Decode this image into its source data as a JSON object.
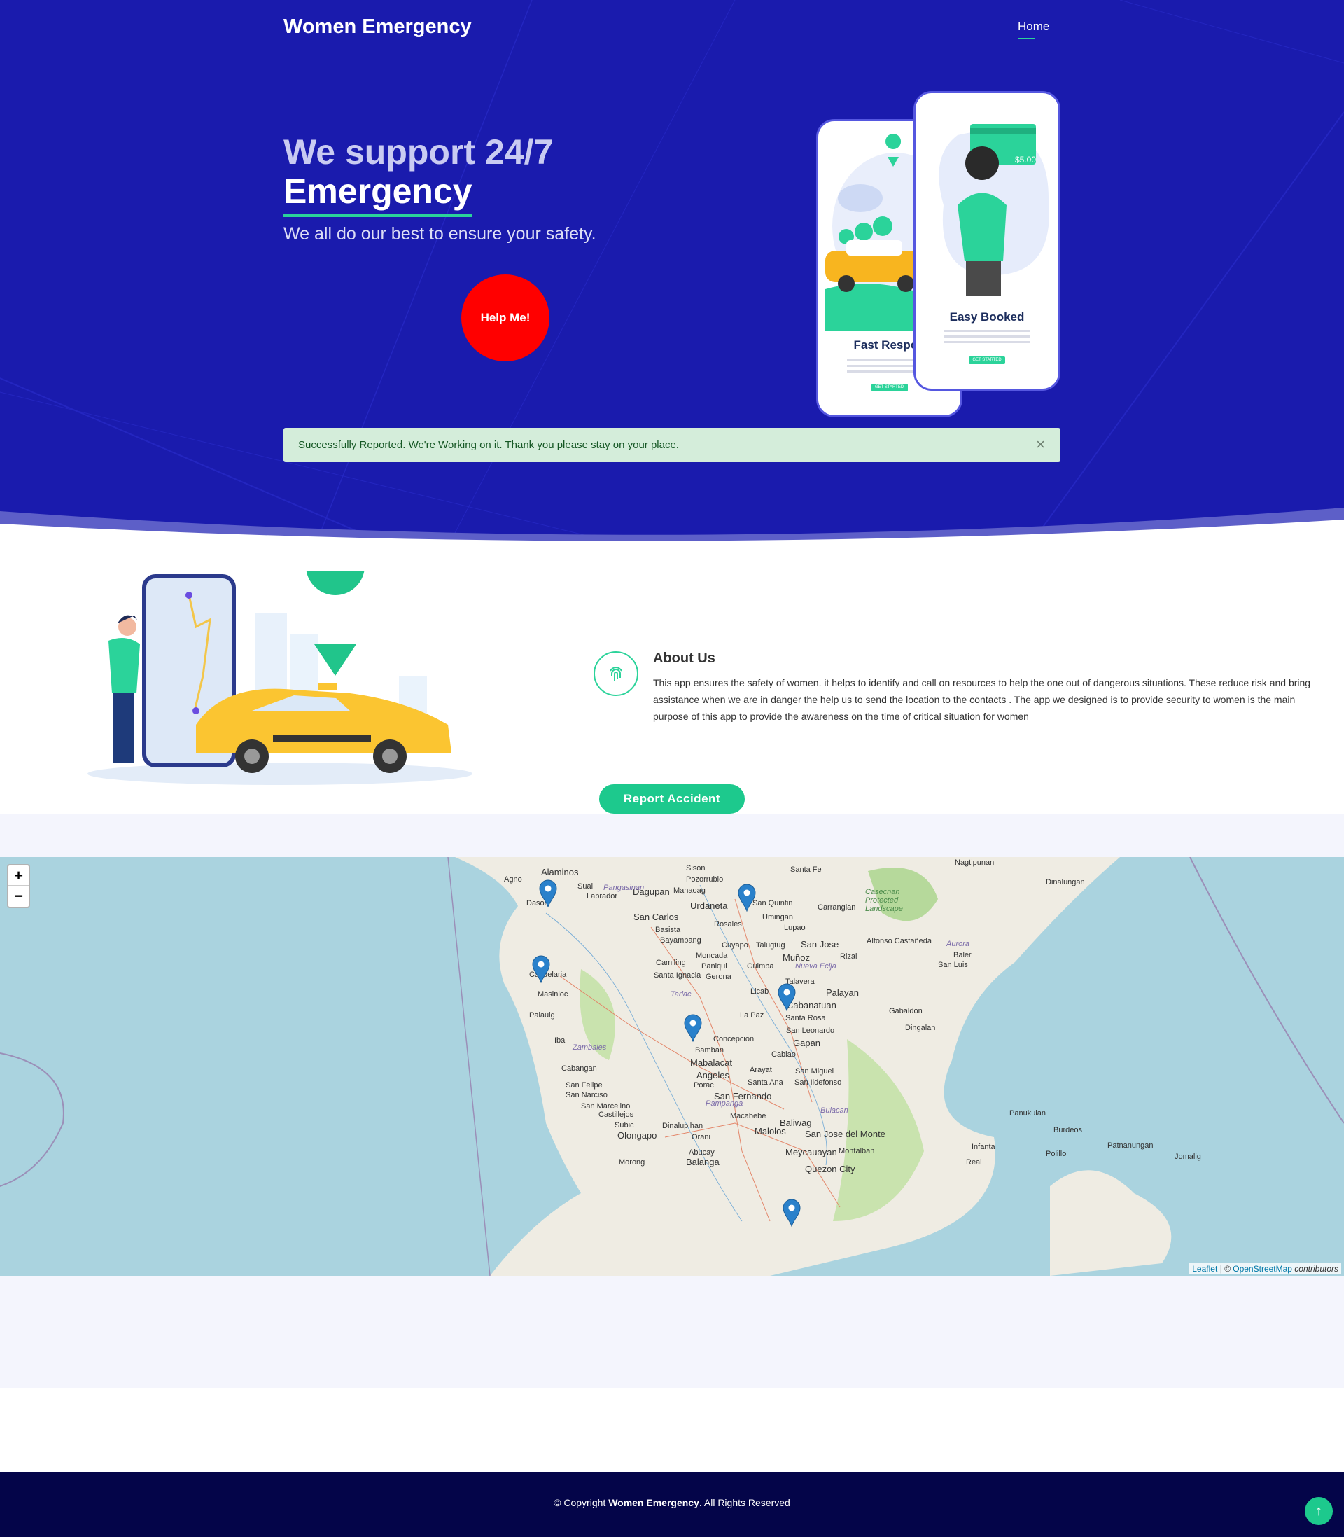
{
  "header": {
    "brand": "Women Emergency",
    "nav_home": "Home"
  },
  "hero": {
    "line1": "We support 24/7",
    "line2": "Emergency",
    "subtitle": "We all do our best to ensure your safety.",
    "help_button": "Help Me!",
    "phone_left": {
      "title": "Fast Respon",
      "button": "GET STARTED"
    },
    "phone_right": {
      "title": "Easy Booked",
      "button": "GET STARTED",
      "price": "$5.00"
    }
  },
  "alert": {
    "message": "Successfully Reported. We're Working on it. Thank you please stay on your place.",
    "close": "×"
  },
  "about": {
    "title": "About Us",
    "text": "This app ensures the safety of women. it helps to identify and call on resources to help the one out of dangerous situations. These reduce risk and bring assistance when we are in danger the help us to send the location to the contacts . The app we designed is to provide security to women is the main purpose of this app to provide the awareness on the time of critical situation for women"
  },
  "report_button": "Report Accident",
  "map": {
    "zoom_in": "+",
    "zoom_out": "−",
    "attribution_leaflet": "Leaflet",
    "attribution_sep": " | © ",
    "attribution_osm": "OpenStreetMap",
    "attribution_tail": " contributors",
    "places": [
      "Alaminos",
      "Agno",
      "Dasol",
      "Sual",
      "Labrador",
      "Dagupan",
      "Manaoag",
      "Pozorrubio",
      "Sison",
      "Urdaneta",
      "San Carlos",
      "Basista",
      "Bayambang",
      "Rosales",
      "San Quintin",
      "Umingan",
      "Lupao",
      "Carranglan",
      "Santa Fe",
      "Cuyapo",
      "Talugtug",
      "San Jose",
      "Alfonso Castañeda",
      "Moncada",
      "Camiling",
      "Paniqui",
      "Guimba",
      "Muñoz",
      "Rizal",
      "Santa Ignacia",
      "Gerona",
      "Talavera",
      "Candelaria",
      "Masinloc",
      "Palauig",
      "Licab",
      "Palayan",
      "Cabanatuan",
      "La Paz",
      "Santa Rosa",
      "San Leonardo",
      "Gabaldon",
      "Dingalan",
      "Concepcion",
      "Gapan",
      "Iba",
      "Bamban",
      "Cabiao",
      "Mabalacat",
      "Angeles",
      "Arayat",
      "San Miguel",
      "Porac",
      "Santa Ana",
      "San Ildefonso",
      "Cabangan",
      "San Felipe",
      "San Narciso",
      "San Fernando",
      "San Marcelino",
      "Castillejos",
      "Macabebe",
      "Subic",
      "Dinalupihan",
      "Malolos",
      "Baliwag",
      "Olongapo",
      "Orani",
      "San Jose del Monte",
      "Meycauayan",
      "Montalban",
      "Abucay",
      "Morong",
      "Balanga",
      "Quezon City",
      "Baler",
      "San Luis",
      "Dinalungan",
      "Panukulan",
      "Burdeos",
      "Patnanungan",
      "Polillo",
      "Infanta",
      "Real",
      "Jomalig",
      "Nagtipunan"
    ],
    "regions": [
      "Pangasinan",
      "Zambales",
      "Pampanga",
      "Bulacan",
      "Nueva Ecija",
      "Aurora",
      "Casecnan Protected Landscape",
      "Tarlac"
    ]
  },
  "footer": {
    "prefix": "© Copyright ",
    "brand": "Women Emergency",
    "suffix": ". All Rights Reserved"
  },
  "back_to_top": "↑",
  "colors": {
    "hero_bg": "#1a1bad",
    "accent": "#1dc98d",
    "help": "#ff0000",
    "footer_bg": "#040549"
  }
}
